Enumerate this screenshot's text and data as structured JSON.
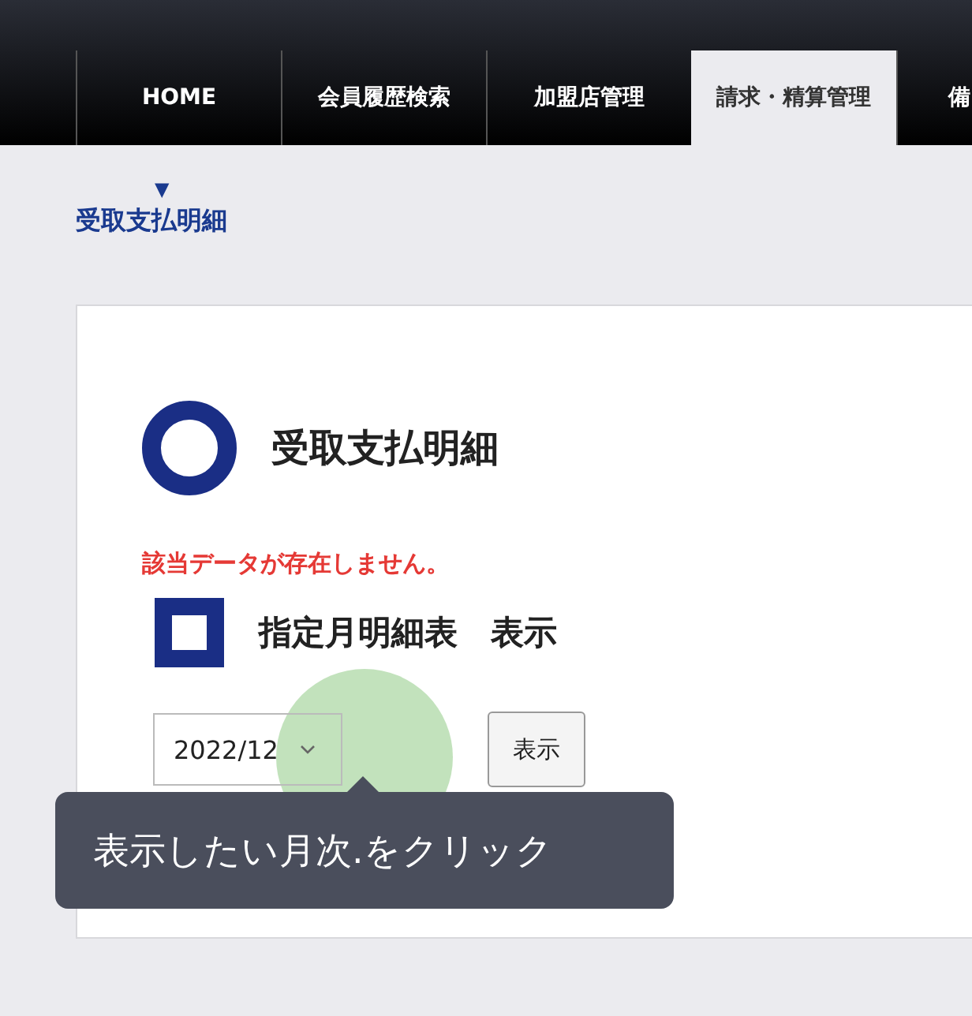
{
  "nav_tabs": [
    {
      "label": "HOME",
      "selected": false
    },
    {
      "label": "会員履歴検索",
      "selected": false
    },
    {
      "label": "加盟店管理",
      "selected": false
    },
    {
      "label": "請求・精算管理",
      "selected": true
    },
    {
      "label": "備",
      "selected": false
    }
  ],
  "breadcrumb": {
    "marker": "▼",
    "label": "受取支払明細"
  },
  "panel": {
    "title": "受取支払明細",
    "error": "該当データが存在しません。",
    "section_title": "指定月明細表　表示",
    "month_select": {
      "value": "2022/12"
    },
    "show_button": "表示"
  },
  "tooltip": {
    "text": "表示したい月次.をクリック"
  }
}
